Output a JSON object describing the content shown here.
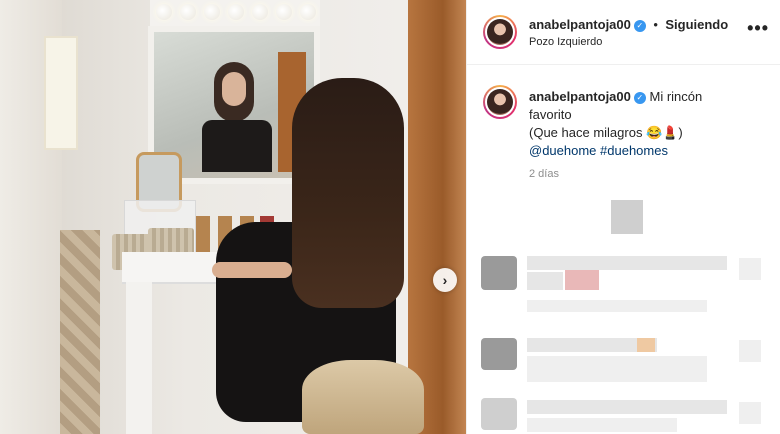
{
  "post": {
    "username": "anabelpantoja00",
    "verified_icon": "verified-badge-icon",
    "separator": "•",
    "follow_label": "Siguiendo",
    "location": "Pozo Izquierdo",
    "more_icon": "•••"
  },
  "caption": {
    "username": "anabelpantoja00",
    "text_line1": "Mi rincón",
    "text_line2": "favorito",
    "text_line3": "(Que hace milagros 😂💄)",
    "mention": "@duehome",
    "hashtag": "#duehomes",
    "time": "2 días"
  },
  "media": {
    "next_icon": "›"
  },
  "colors": {
    "text": "#262626",
    "link": "#00376b",
    "verified": "#3897f0",
    "muted": "#8e8e8e"
  }
}
